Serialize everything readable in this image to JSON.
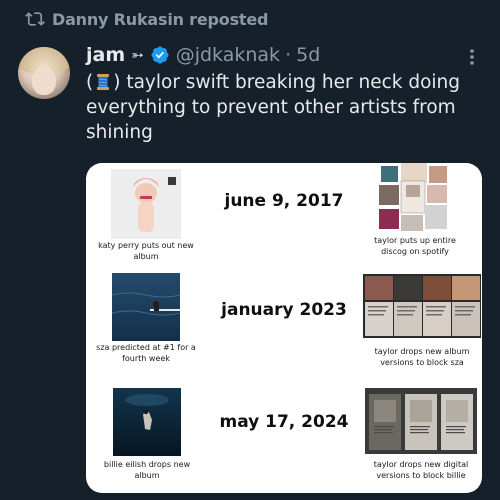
{
  "repost": {
    "text": "Danny Rukasin reposted"
  },
  "author": {
    "name": "jam",
    "emoji": "➳",
    "handle": "@jdkaknak",
    "separator": "·",
    "time": "5d"
  },
  "tweet": {
    "text_open": "(",
    "text_close": ") taylor swift breaking her neck doing everything to prevent other artists from shining"
  },
  "media": {
    "rows": [
      {
        "date": "june 9, 2017",
        "left_caption": "katy perry puts out new album",
        "right_caption": "taylor puts up entire discog on spotify"
      },
      {
        "date": "january 2023",
        "left_caption": "sza predicted at #1 for a fourth week",
        "right_caption": "taylor drops new album versions to block sza"
      },
      {
        "date": "may 17, 2024",
        "left_caption": "billie eilish drops new album",
        "right_caption": "taylor drops new digital versions to block billie"
      }
    ]
  },
  "colors": {
    "background": "#15202b",
    "text": "#e7e9ea",
    "muted": "#8b98a5",
    "verified": "#1d9bf0",
    "card": "#ffffff"
  }
}
